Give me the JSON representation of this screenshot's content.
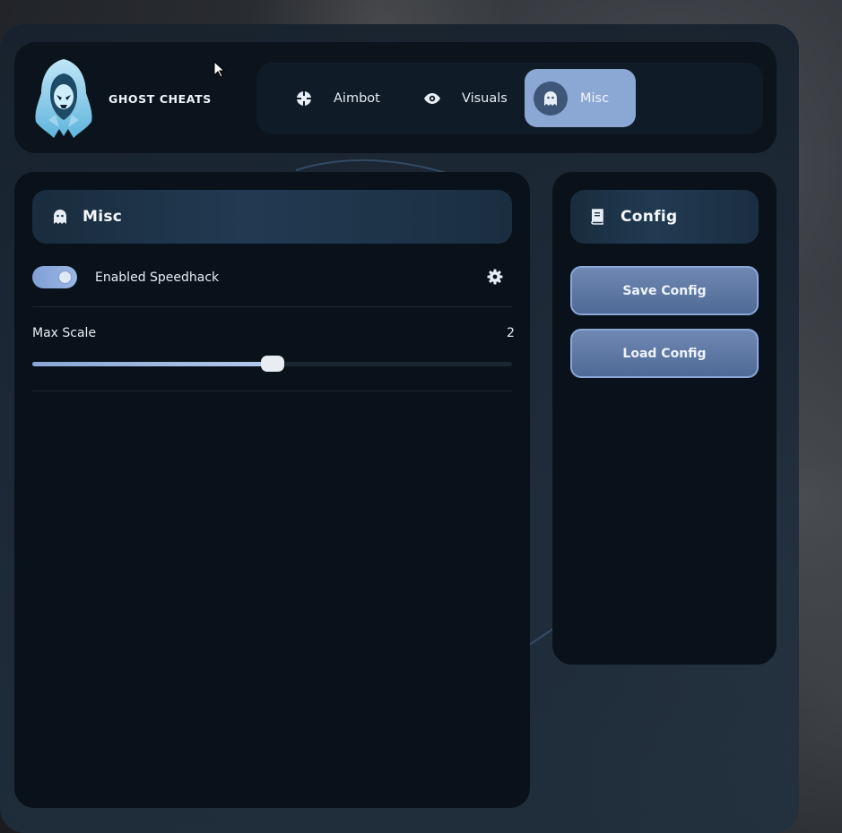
{
  "app": {
    "brand": "GHOST CHEATS"
  },
  "tabs": [
    {
      "label": "Aimbot",
      "icon": "crosshair-icon",
      "active": false
    },
    {
      "label": "Visuals",
      "icon": "eye-icon",
      "active": true
    },
    {
      "label": "Misc",
      "icon": "ghost-icon",
      "active": true
    }
  ],
  "misc_panel": {
    "title": "Misc",
    "icon": "ghost-icon",
    "speedhack": {
      "label": "Enabled Speedhack",
      "enabled": true,
      "settings_icon": "gear-icon"
    },
    "max_scale": {
      "label": "Max Scale",
      "value": "2",
      "fill_fraction": 0.5
    }
  },
  "config_panel": {
    "title": "Config",
    "icon": "book-icon",
    "save_label": "Save Config",
    "load_label": "Load Config"
  },
  "colors": {
    "accent": "#8ba8d4",
    "panel_bg": "#09121a",
    "button_border": "#8aa7d8"
  }
}
